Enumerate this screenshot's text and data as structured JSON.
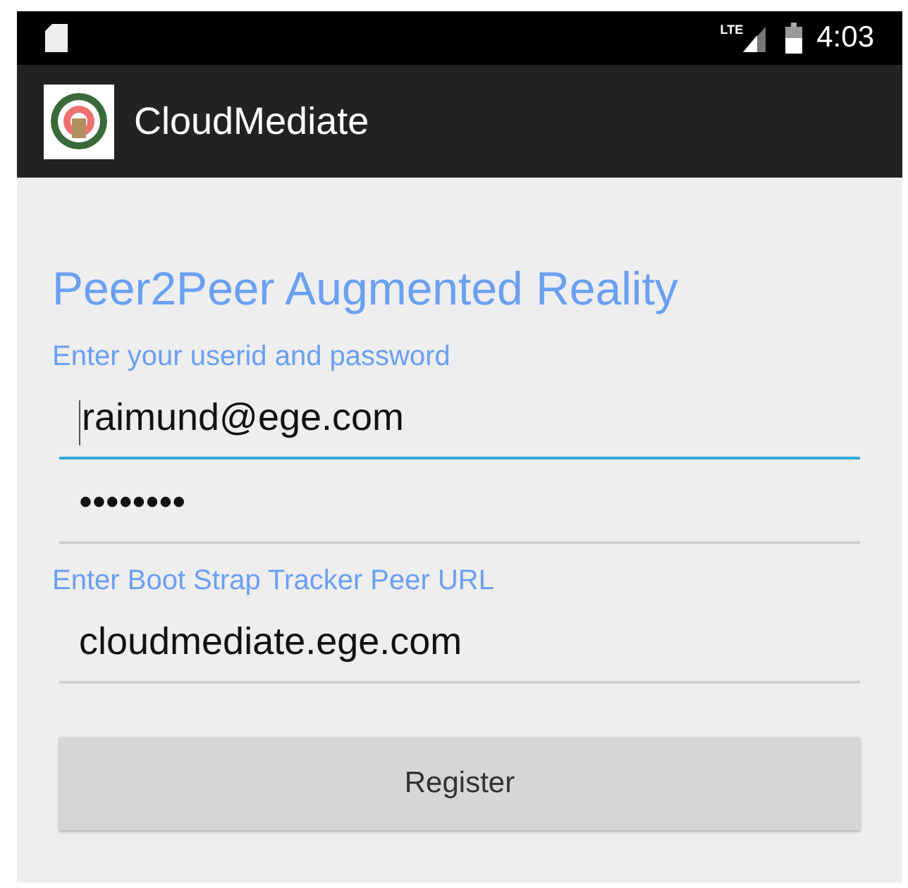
{
  "status_bar": {
    "network": "LTE",
    "time": "4:03"
  },
  "app_bar": {
    "title": "CloudMediate"
  },
  "heading": "Peer2Peer Augmented Reality",
  "sections": [
    {
      "label": "Enter your userid and password",
      "fields": [
        {
          "value": "raimund@ege.com",
          "focused": true
        },
        {
          "value": "••••••••",
          "focused": false
        }
      ]
    },
    {
      "label": "Enter Boot Strap Tracker Peer URL",
      "fields": [
        {
          "value": "cloudmediate.ege.com",
          "focused": false
        }
      ]
    }
  ],
  "button": "Register"
}
